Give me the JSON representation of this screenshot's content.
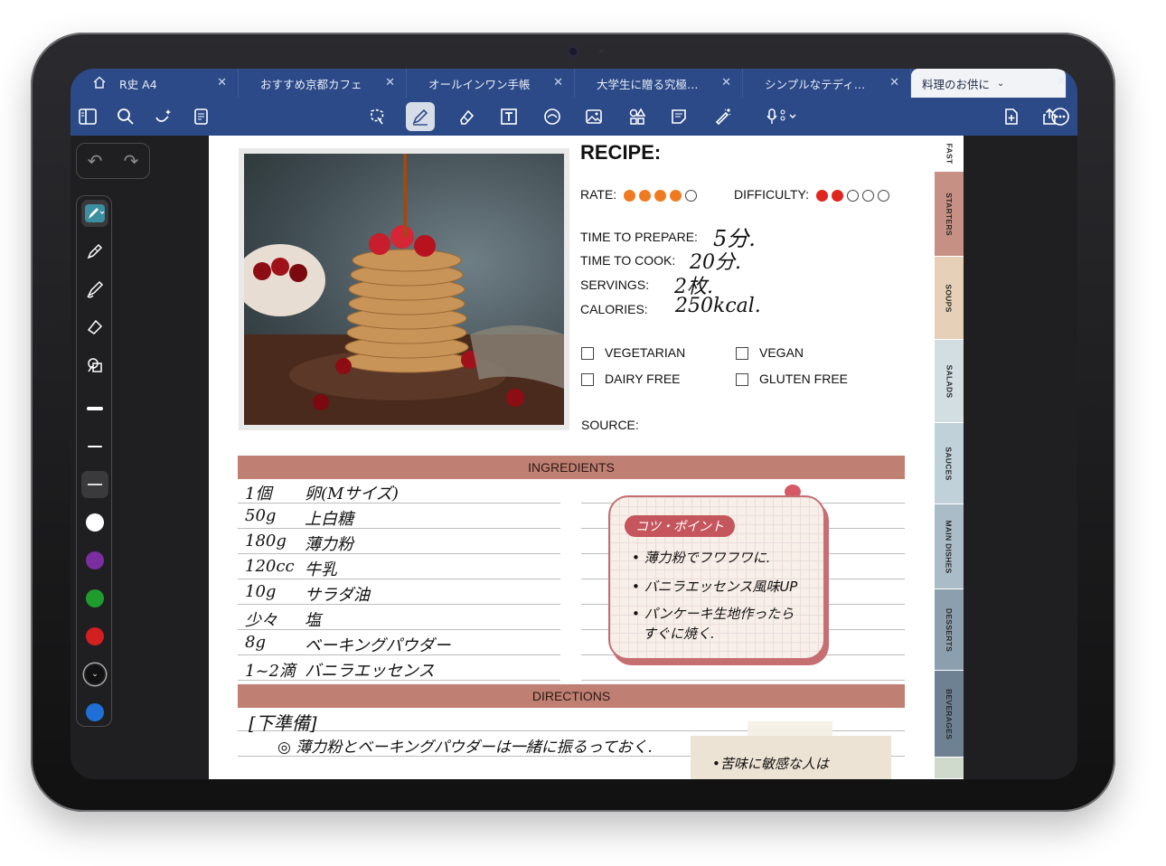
{
  "tabs": [
    {
      "label": "R史 A4"
    },
    {
      "label": "おすすめ京都カフェ"
    },
    {
      "label": "オールインワン手帳"
    },
    {
      "label": "大学生に贈る究極…"
    },
    {
      "label": "シンプルなテディ…"
    },
    {
      "label": "料理のお供に"
    }
  ],
  "toolbar_icons": [
    "sidebar-icon",
    "search-icon",
    "magic-icon",
    "notes-icon",
    "lasso-icon",
    "pen-icon",
    "eraser-icon",
    "text-icon",
    "shapes-icon",
    "image-icon",
    "elements-icon",
    "sticky-icon",
    "laser-icon",
    "mic-icon",
    "add-page-icon",
    "share-icon",
    "more-icon"
  ],
  "palette": {
    "colors": [
      "#ffffff",
      "#7a2ea0",
      "#1e9c2e",
      "#d21f1f",
      "#111111",
      "#1f6fd6"
    ]
  },
  "recipe": {
    "title": "RECIPE:",
    "rate_label": "RATE:",
    "rate": 4,
    "rate_max": 5,
    "difficulty_label": "DIFFICULTY:",
    "difficulty": 2,
    "difficulty_max": 5,
    "prepare_label": "TIME TO PREPARE:",
    "prepare_value": "5分.",
    "cook_label": "TIME TO COOK:",
    "cook_value": "20分.",
    "servings_label": "SERVINGS:",
    "servings_value": "2枚.",
    "calories_label": "CALORIES:",
    "calories_value": "250kcal.",
    "options": {
      "vegetarian": "VEGETARIAN",
      "vegan": "VEGAN",
      "dairy_free": "DAIRY FREE",
      "gluten_free": "GLUTEN FREE"
    },
    "source_label": "SOURCE:"
  },
  "ingredients_header": "INGREDIENTS",
  "ingredients": [
    {
      "qty": "1個",
      "item": "卵(Mサイズ)"
    },
    {
      "qty": "50g",
      "item": "上白糖"
    },
    {
      "qty": "180g",
      "item": "薄力粉"
    },
    {
      "qty": "120cc",
      "item": "牛乳"
    },
    {
      "qty": "10g",
      "item": "サラダ油"
    },
    {
      "qty": "少々",
      "item": "塩"
    },
    {
      "qty": "8g",
      "item": "ベーキングパウダー"
    },
    {
      "qty": "1~2滴",
      "item": "バニラエッセンス"
    }
  ],
  "note": {
    "tag": "コツ・ポイント",
    "points": [
      "• 薄力粉でフワフワに.",
      "• バニラエッセンス風味UP",
      "• パンケーキ生地作ったら",
      "  すぐに焼く."
    ]
  },
  "directions_header": "DIRECTIONS",
  "directions": {
    "heading": "[下準備]",
    "step": "◎ 薄力粉とベーキングパウダーは一緒に振るっておく."
  },
  "sticky_text": "•苦味に敏感な人は",
  "side_tabs": [
    {
      "label": "FAST",
      "color": "#ffffff"
    },
    {
      "label": "STARTERS",
      "color": "#c79084"
    },
    {
      "label": "SOUPS",
      "color": "#e6d1b8"
    },
    {
      "label": "SALADS",
      "color": "#d3dee2"
    },
    {
      "label": "SAUCES",
      "color": "#c1d1d9"
    },
    {
      "label": "MAIN DISHES",
      "color": "#a9bcc8"
    },
    {
      "label": "DESSERTS",
      "color": "#8c9fae"
    },
    {
      "label": "BEVERAGES",
      "color": "#6d8193"
    },
    {
      "label": "",
      "color": "#cfd9cc"
    }
  ]
}
